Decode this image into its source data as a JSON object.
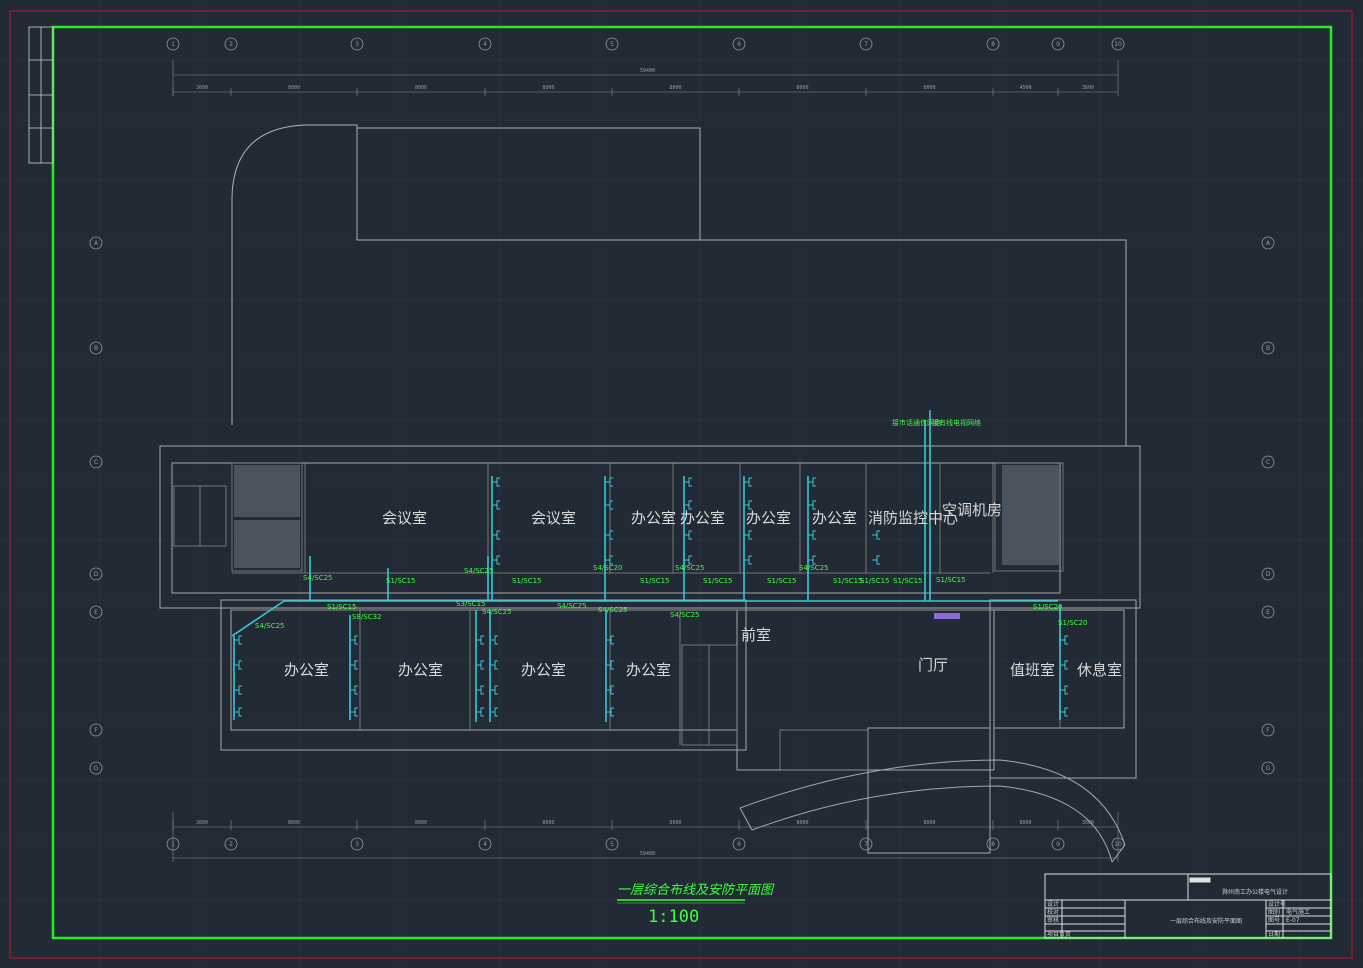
{
  "drawing": {
    "title": "一层综合布线及安防平面图",
    "scale": "1:100",
    "colors": {
      "background": "#222a35",
      "frame_outer": "#c8102e",
      "frame_inner": "#22ee22",
      "walls": "#a8a8a8",
      "cable_tray": "#33c9d8",
      "labels_green": "#3cff3c",
      "text": "#d9d9d9",
      "wall_hatch": "#bfbfbf"
    }
  },
  "axes_top": [
    "1",
    "2",
    "3",
    "4",
    "5",
    "6",
    "7",
    "8",
    "9",
    "10"
  ],
  "axes_side": [
    "A",
    "B",
    "C",
    "D",
    "E",
    "F",
    "G"
  ],
  "dims": {
    "overall": "59400",
    "top_spans": [
      "3600",
      "8000",
      "8000",
      "8000",
      "8000",
      "8000",
      "8000",
      "4500",
      "3600"
    ],
    "bottom_spans": [
      "3600",
      "8000",
      "8000",
      "8000",
      "8000",
      "8000",
      "8000",
      "8000",
      "3600"
    ]
  },
  "rooms": {
    "meeting_1": "会议室",
    "meeting_2": "会议室",
    "office_n1": "办公室",
    "office_n2": "办公室",
    "office_n3": "办公室",
    "office_n4": "办公室",
    "fire_control": "消防监控中心",
    "ac_room": "空调机房",
    "office_s1": "办公室",
    "office_s2": "办公室",
    "office_s3": "办公室",
    "office_s4": "办公室",
    "front_room": "前室",
    "lobby": "门厅",
    "duty_room": "值班室",
    "rest_room": "休息室"
  },
  "cable_labels": [
    "S4/SC25",
    "S1/SC15",
    "S4/SC25",
    "S1/SC15",
    "S4/SC20",
    "S1/SC15",
    "S4/SC25",
    "S1/SC15",
    "S1/SC15",
    "S4/SC25",
    "S1/SC15",
    "S1/SC15",
    "S1/SC15",
    "S1/SC15",
    "S1/SC20",
    "S1/SC15",
    "S8/SC32",
    "S4/SC25",
    "S4/SC25",
    "S3/SC15",
    "S4/SC25",
    "S4/SC25",
    "S4/SC25",
    "S1/SC20"
  ],
  "top_notes": {
    "from_outside": "接市话通信网络",
    "from_tv": "接有线电视网络"
  },
  "title_block": {
    "project": "滁州南工办公楼电气设计",
    "drawing_name": "一层综合布线及安防平面图",
    "row_labels": [
      "设计",
      "校对",
      "审核",
      "项目负责"
    ],
    "right_labels": [
      "设计号",
      "图别",
      "图号",
      "日期"
    ],
    "right_values": [
      "",
      "电气施工",
      "E-07",
      ""
    ]
  }
}
